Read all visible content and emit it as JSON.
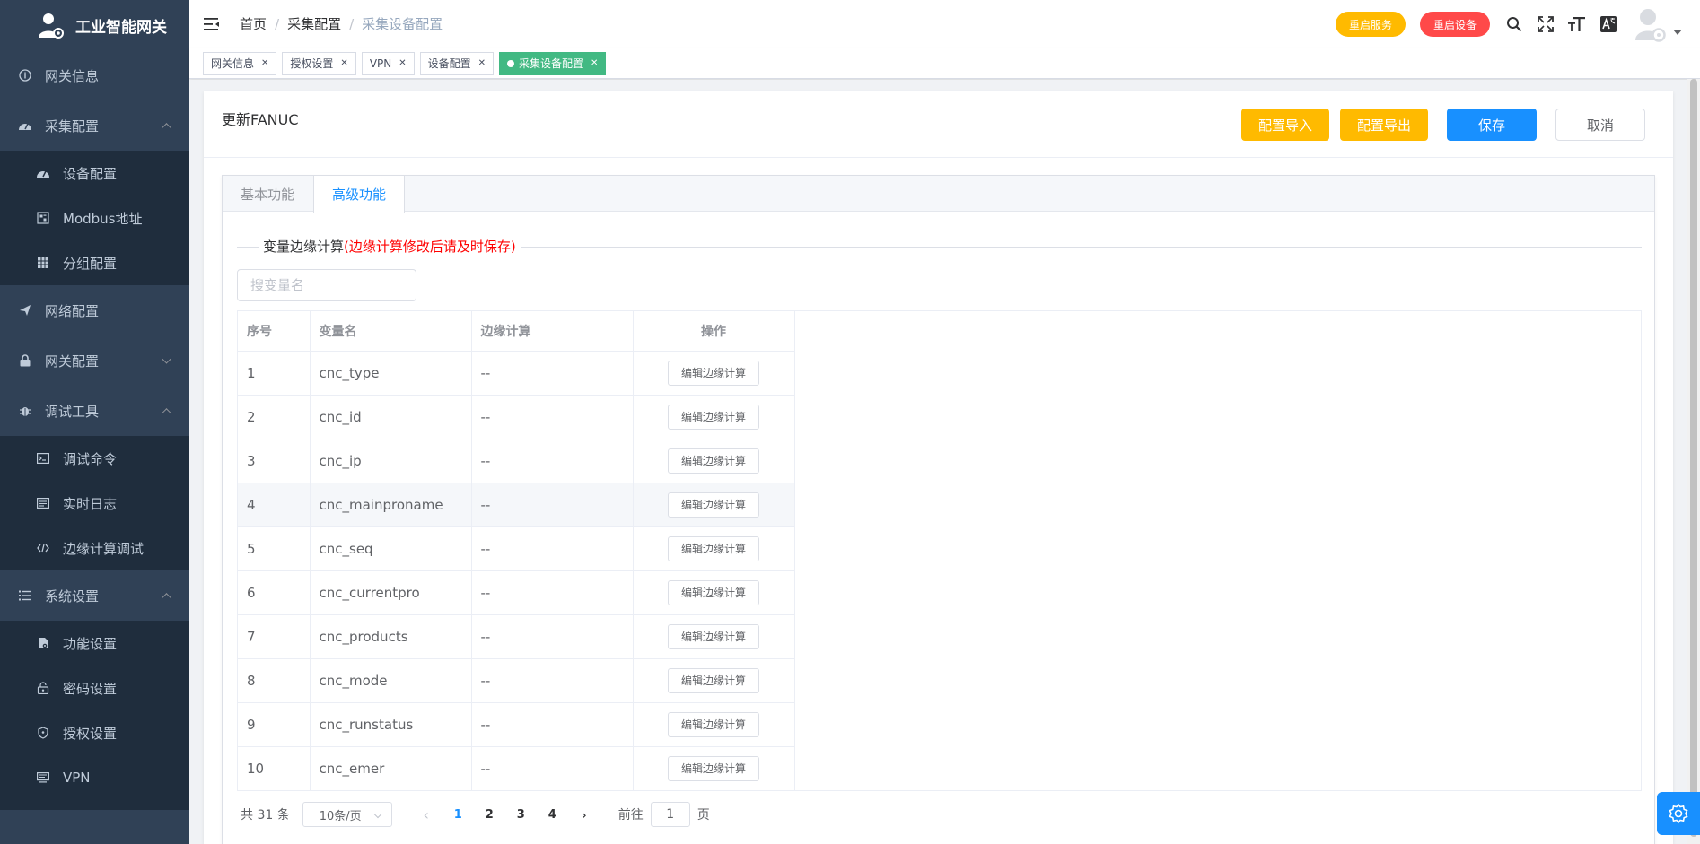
{
  "sidebar": {
    "logo_title": "工业智能网关",
    "items": [
      {
        "label": "网关信息"
      },
      {
        "label": "采集配置",
        "children": [
          {
            "label": "设备配置"
          },
          {
            "label": "Modbus地址"
          },
          {
            "label": "分组配置"
          }
        ]
      },
      {
        "label": "网络配置"
      },
      {
        "label": "网关配置"
      },
      {
        "label": "调试工具",
        "children": [
          {
            "label": "调试命令"
          },
          {
            "label": "实时日志"
          },
          {
            "label": "边缘计算调试"
          }
        ]
      },
      {
        "label": "系统设置",
        "children": [
          {
            "label": "功能设置"
          },
          {
            "label": "密码设置"
          },
          {
            "label": "授权设置"
          },
          {
            "label": "VPN"
          }
        ]
      }
    ]
  },
  "navbar": {
    "breadcrumb": [
      "首页",
      "采集配置",
      "采集设备配置"
    ],
    "restart_service": "重启服务",
    "restart_device": "重启设备"
  },
  "tags": [
    {
      "label": "网关信息"
    },
    {
      "label": "授权设置"
    },
    {
      "label": "VPN"
    },
    {
      "label": "设备配置"
    },
    {
      "label": "采集设备配置",
      "active": true
    }
  ],
  "card": {
    "title": "更新FANUC",
    "import_label": "配置导入",
    "export_label": "配置导出",
    "save_label": "保存",
    "cancel_label": "取消"
  },
  "tabs": [
    "基本功能",
    "高级功能"
  ],
  "section": {
    "title": "变量边缘计算",
    "note": "(边缘计算修改后请及时保存)"
  },
  "search": {
    "placeholder": "搜变量名"
  },
  "table": {
    "headers": [
      "序号",
      "变量名",
      "边缘计算",
      "操作"
    ],
    "action_label": "编辑边缘计算",
    "rows": [
      {
        "no": "1",
        "name": "cnc_type",
        "calc": "--"
      },
      {
        "no": "2",
        "name": "cnc_id",
        "calc": "--"
      },
      {
        "no": "3",
        "name": "cnc_ip",
        "calc": "--"
      },
      {
        "no": "4",
        "name": "cnc_mainproname",
        "calc": "--"
      },
      {
        "no": "5",
        "name": "cnc_seq",
        "calc": "--"
      },
      {
        "no": "6",
        "name": "cnc_currentpro",
        "calc": "--"
      },
      {
        "no": "7",
        "name": "cnc_products",
        "calc": "--"
      },
      {
        "no": "8",
        "name": "cnc_mode",
        "calc": "--"
      },
      {
        "no": "9",
        "name": "cnc_runstatus",
        "calc": "--"
      },
      {
        "no": "10",
        "name": "cnc_emer",
        "calc": "--"
      }
    ]
  },
  "pagination": {
    "total": "共 31 条",
    "page_size": "10条/页",
    "pages": [
      "1",
      "2",
      "3",
      "4"
    ],
    "current": "1",
    "goto_prefix": "前往",
    "goto_value": "1",
    "goto_suffix": "页"
  },
  "colors": {
    "sidebar_bg": "#304156",
    "submenu_bg": "#1f2d3d",
    "primary": "#1890ff",
    "warning": "#ffba00",
    "danger": "#ff4949",
    "tag_active": "#42b983"
  }
}
